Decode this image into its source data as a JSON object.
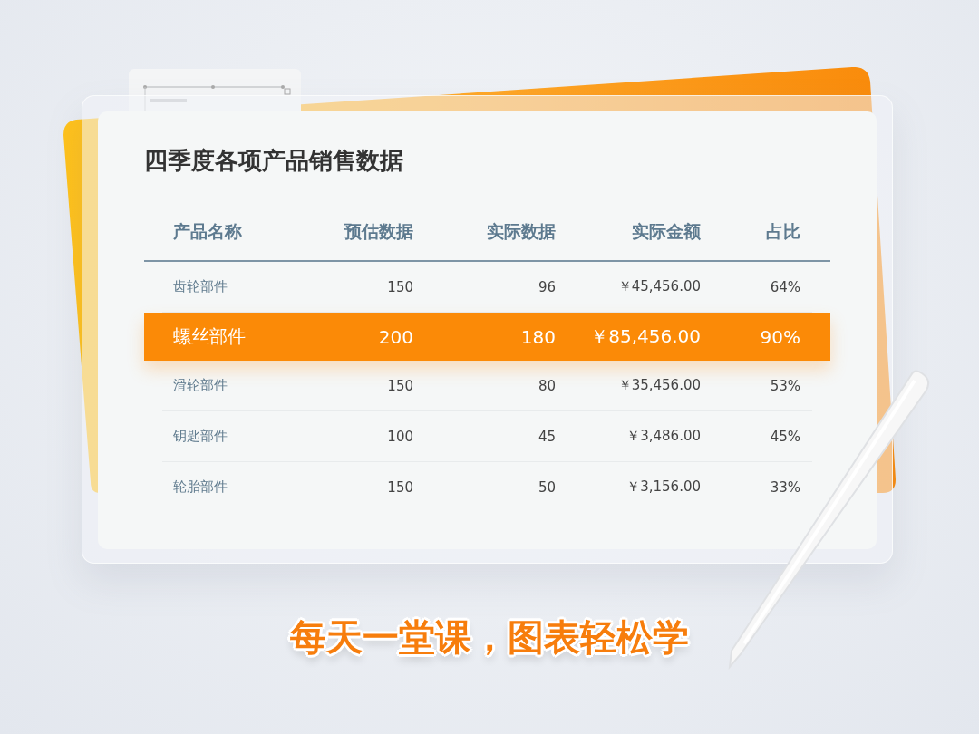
{
  "title": "四季度各项产品销售数据",
  "table": {
    "columns": [
      "产品名称",
      "预估数据",
      "实际数据",
      "实际金额",
      "占比"
    ],
    "rows": [
      {
        "cells": [
          "齿轮部件",
          "150",
          "96",
          "￥45,456.00",
          "64%"
        ],
        "selected": false
      },
      {
        "cells": [
          "螺丝部件",
          "200",
          "180",
          "￥85,456.00",
          "90%"
        ],
        "selected": true
      },
      {
        "cells": [
          "滑轮部件",
          "150",
          "80",
          "￥35,456.00",
          "53%"
        ],
        "selected": false
      },
      {
        "cells": [
          "钥匙部件",
          "100",
          "45",
          "￥3,486.00",
          "45%"
        ],
        "selected": false
      },
      {
        "cells": [
          "轮胎部件",
          "150",
          "50",
          "￥3,156.00",
          "33%"
        ],
        "selected": false
      }
    ]
  },
  "slogan": "每天一堂课，图表轻松学"
}
